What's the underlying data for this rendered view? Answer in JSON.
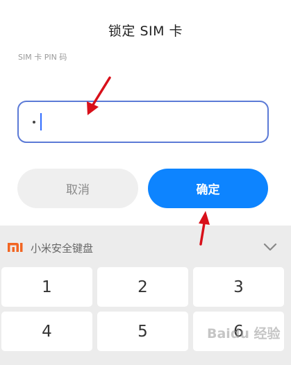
{
  "dialog": {
    "title": "锁定 SIM 卡",
    "field_label": "SIM 卡 PIN 码",
    "pin_input": {
      "value": "•",
      "masked_digits": 1
    },
    "cancel_label": "取消",
    "confirm_label": "确定"
  },
  "keyboard": {
    "logo": "mi-logo",
    "title": "小米安全键盘",
    "collapse_icon": "chevron-down-icon",
    "keys": [
      "1",
      "2",
      "3",
      "4",
      "5",
      "6"
    ]
  },
  "watermark": "Baidu 经验",
  "colors": {
    "accent": "#0d84ff",
    "input_border": "#5b7ad6",
    "annotation_arrow": "#d8101a",
    "brand": "#f26522"
  }
}
